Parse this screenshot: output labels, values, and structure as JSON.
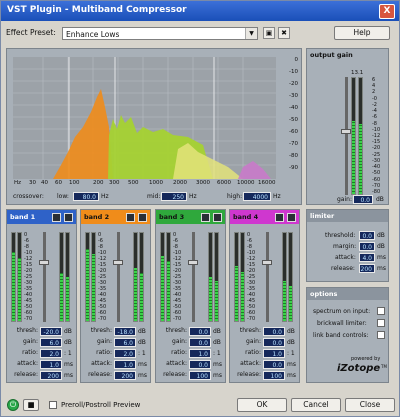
{
  "window": {
    "title": "VST Plugin - Multiband Compressor",
    "close_glyph": "X"
  },
  "preset": {
    "label": "Effect Preset:",
    "value": "Enhance Lows",
    "save_glyph": "▣",
    "delete_glyph": "✖",
    "help_label": "Help"
  },
  "spectrum": {
    "db_scale": [
      "0",
      "-10",
      "-20",
      "-30",
      "-40",
      "-50",
      "-60",
      "-70",
      "-80",
      "-90"
    ],
    "freq_ticks": [
      "Hz",
      "30",
      "40",
      "60",
      "100",
      "200",
      "300",
      "500",
      "1000",
      "2000",
      "3000",
      "6000",
      "10000",
      "16000"
    ],
    "crossover_label": "crossover:",
    "low_label": "low:",
    "low_value": "80.0",
    "low_unit": "Hz",
    "mid_label": "mid:",
    "mid_value": "250",
    "mid_unit": "Hz",
    "high_label": "high:",
    "high_value": "4000",
    "high_unit": "Hz"
  },
  "output": {
    "title": "output gain",
    "peak": "13.1",
    "scale": [
      "6",
      "4",
      "2",
      "-0",
      "-2",
      "-4",
      "-6",
      "-8",
      "-10",
      "-12",
      "-15",
      "-20",
      "-25",
      "-30",
      "-40",
      "-50",
      "-60",
      "-70",
      "-80"
    ],
    "gain_label": "gain:",
    "gain_value": "0.0",
    "gain_unit": "dB",
    "level": 0.63,
    "peak_color": "#3bd24a"
  },
  "bands": [
    {
      "title": "band 1",
      "color": "#2f62c8",
      "text_color": "#ffffff",
      "thresh": "-20.0",
      "gain": "6.0",
      "ratio": "2.0",
      "attack": "1.0",
      "release": "200",
      "level_in": 0.78,
      "level_out": 0.55
    },
    {
      "title": "band 2",
      "color": "#f08c1a",
      "text_color": "#111111",
      "thresh": "-18.0",
      "gain": "6.0",
      "ratio": "2.0",
      "attack": "1.0",
      "release": "200",
      "level_in": 0.82,
      "level_out": 0.6
    },
    {
      "title": "band 3",
      "color": "#2fa83c",
      "text_color": "#111111",
      "thresh": "0.0",
      "gain": "0.0",
      "ratio": "1.0",
      "attack": "0.0",
      "release": "100",
      "level_in": 0.74,
      "level_out": 0.5
    },
    {
      "title": "band 4",
      "color": "#cf37cf",
      "text_color": "#111111",
      "thresh": "0.0",
      "gain": "0.0",
      "ratio": "1.0",
      "attack": "0.0",
      "release": "100",
      "level_in": 0.62,
      "level_out": 0.45
    }
  ],
  "band_params": {
    "thresh": "thresh:",
    "gain": "gain:",
    "ratio": "ratio:",
    "attack": "attack:",
    "release": "release:"
  },
  "band_units": {
    "thresh": "dB",
    "gain": "dB",
    "ratio": ": 1",
    "attack": "ms",
    "release": "ms"
  },
  "band_scale": [
    "0",
    "-6",
    "-8",
    "-10",
    "-12",
    "-15",
    "-20",
    "-25",
    "-30",
    "-35",
    "-40",
    "-45",
    "-50",
    "-60",
    "-70"
  ],
  "limiter": {
    "title": "limiter",
    "threshold_label": "threshold:",
    "threshold": "0.0",
    "margin_label": "margin:",
    "margin": "0.0",
    "attack_label": "attack:",
    "attack": "4.0",
    "release_label": "release:",
    "release": "200",
    "unit_db": "dB",
    "unit_ms": "ms"
  },
  "options": {
    "title": "options",
    "items": [
      "spectrum on input:",
      "brickwall limiter:",
      "link band controls:"
    ]
  },
  "brand": {
    "powered_by": "powered by",
    "name": "iZotope",
    "tm": "TM"
  },
  "bottom": {
    "preroll": "Preroll/Postroll Preview",
    "ok": "OK",
    "cancel": "Cancel",
    "close": "Close"
  }
}
